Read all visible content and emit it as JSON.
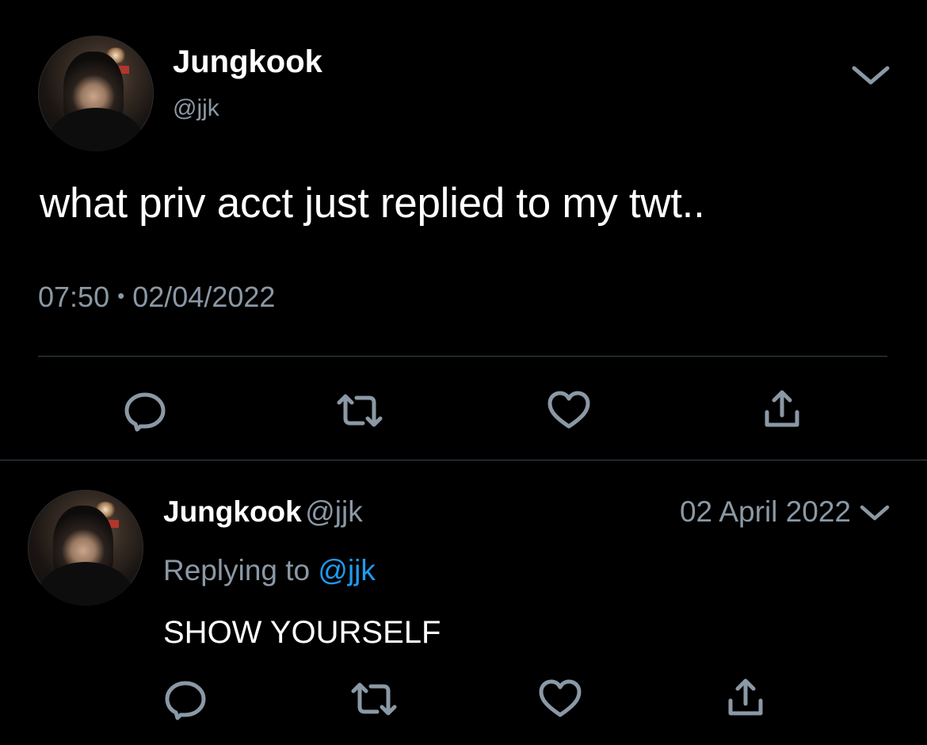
{
  "main_tweet": {
    "author_name": "Jungkook",
    "handle": "@jjk",
    "text": "what priv acct just replied to my twt..",
    "time": "07:50",
    "separator": "•",
    "date": "02/04/2022"
  },
  "reply_tweet": {
    "author_name": "Jungkook",
    "handle": "@jjk",
    "date": "02 April 2022",
    "replying_prefix": "Replying to",
    "replying_to": "@jjk",
    "text": "SHOW YOURSELF"
  },
  "icons": {
    "caret": "chevron-down-icon",
    "reply": "reply-icon",
    "retweet": "retweet-icon",
    "like": "heart-icon",
    "share": "share-icon"
  },
  "colors": {
    "background": "#000000",
    "text": "#ffffff",
    "secondary": "#8b98a5",
    "link": "#1d9bf0",
    "divider": "#38444d"
  }
}
